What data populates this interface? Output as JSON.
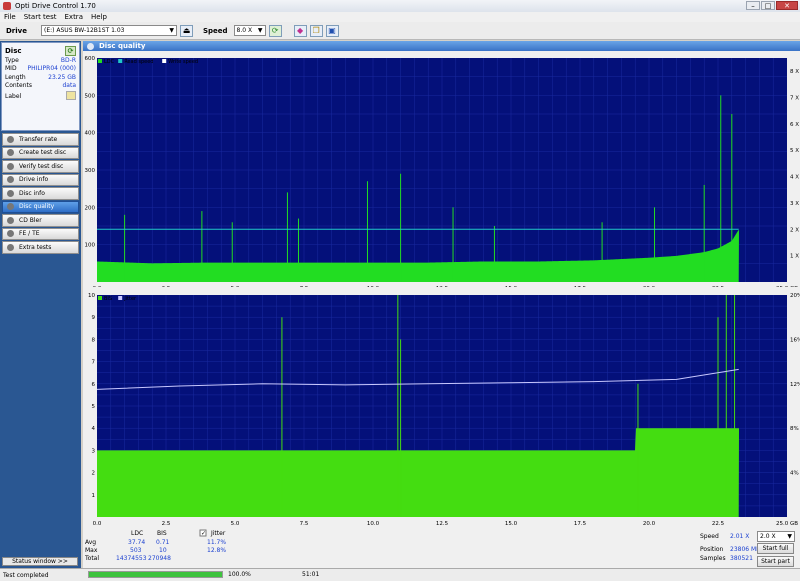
{
  "window": {
    "title": "Opti Drive Control 1.70",
    "controls": [
      "–",
      "□",
      "✕"
    ]
  },
  "menu": [
    "File",
    "Start test",
    "Extra",
    "Help"
  ],
  "toolbar": {
    "drive_label": "Drive",
    "drive_value": "(E:)  ASUS BW-12B1ST 1.03",
    "speed_label": "Speed",
    "speed_value": "8.0 X"
  },
  "disc": {
    "heading": "Disc",
    "rows": [
      {
        "key": "Type",
        "value": "BD-R"
      },
      {
        "key": "MID",
        "value": "PHILIPR04 (000)"
      },
      {
        "key": "Length",
        "value": "23.25 GB"
      },
      {
        "key": "Contents",
        "value": "data"
      },
      {
        "key": "Label",
        "value": ""
      }
    ]
  },
  "nav": [
    {
      "label": "Transfer rate",
      "active": false
    },
    {
      "label": "Create test disc",
      "active": false
    },
    {
      "label": "Verify test disc",
      "active": false
    },
    {
      "label": "Drive info",
      "active": false
    },
    {
      "label": "Disc info",
      "active": false
    },
    {
      "label": "Disc quality",
      "active": true
    },
    {
      "label": "CD Bler",
      "active": false
    },
    {
      "label": "FE / TE",
      "active": false
    },
    {
      "label": "Extra tests",
      "active": false
    }
  ],
  "status_window_label": "Status window >>",
  "panel_title": "Disc quality",
  "chart_data": [
    {
      "type": "area",
      "legend": [
        "LDC",
        "Read speed",
        "Write speed"
      ],
      "legend_placement": "top-left",
      "x_ticks": [
        "0.0",
        "2.5",
        "5.0",
        "7.5",
        "10.0",
        "12.5",
        "15.0",
        "17.5",
        "20.0",
        "22.5",
        "25.0 GB"
      ],
      "y_ticks_left": [
        "100",
        "200",
        "300",
        "400",
        "500",
        "600"
      ],
      "y_ticks_right": [
        "1 X",
        "2 X",
        "3 X",
        "4 X",
        "5 X",
        "6 X",
        "7 X",
        "8 X"
      ],
      "xlim": [
        0,
        25
      ],
      "ylim": [
        0,
        600
      ],
      "y2lim": [
        0,
        8.5
      ],
      "grid": true,
      "series": [
        {
          "name": "LDC",
          "color": "#22dd22",
          "x": [
            0,
            2,
            4,
            6,
            8,
            10,
            12,
            14,
            16,
            18,
            20,
            21,
            22,
            22.5,
            23,
            23.25
          ],
          "y": [
            55,
            50,
            52,
            52,
            52,
            52,
            52,
            55,
            55,
            58,
            65,
            70,
            80,
            90,
            110,
            140
          ]
        },
        {
          "name": "Read speed",
          "color": "#20c8c8",
          "x": [
            0,
            23.25
          ],
          "y": [
            2.0,
            2.0
          ]
        }
      ],
      "spikes": [
        {
          "x": 1.0,
          "y": 180
        },
        {
          "x": 3.8,
          "y": 190
        },
        {
          "x": 4.9,
          "y": 160
        },
        {
          "x": 6.9,
          "y": 240
        },
        {
          "x": 7.3,
          "y": 170
        },
        {
          "x": 9.8,
          "y": 270
        },
        {
          "x": 11.0,
          "y": 290
        },
        {
          "x": 12.9,
          "y": 200
        },
        {
          "x": 14.4,
          "y": 150
        },
        {
          "x": 18.3,
          "y": 160
        },
        {
          "x": 20.2,
          "y": 200
        },
        {
          "x": 22.0,
          "y": 260
        },
        {
          "x": 22.6,
          "y": 500
        },
        {
          "x": 23.0,
          "y": 450
        }
      ]
    },
    {
      "type": "area",
      "legend": [
        "BIS",
        "Jitter"
      ],
      "legend_placement": "top-left",
      "x_ticks": [
        "0.0",
        "2.5",
        "5.0",
        "7.5",
        "10.0",
        "12.5",
        "15.0",
        "17.5",
        "20.0",
        "22.5",
        "25.0 GB"
      ],
      "y_ticks_left": [
        "1",
        "2",
        "3",
        "4",
        "5",
        "6",
        "7",
        "8",
        "9",
        "10"
      ],
      "y_ticks_right": [
        "4%",
        "8%",
        "12%",
        "16%",
        "20%"
      ],
      "xlim": [
        0,
        25
      ],
      "ylim": [
        0,
        10
      ],
      "y2lim": [
        0,
        20
      ],
      "grid": true,
      "series": [
        {
          "name": "BIS",
          "color": "#44dd11",
          "x": [
            0,
            19.5,
            19.5,
            23.25
          ],
          "y": [
            3,
            3,
            4,
            4
          ]
        },
        {
          "name": "Jitter",
          "color": "#c8c8ff",
          "x": [
            0,
            3,
            6,
            9,
            12,
            15,
            18,
            21,
            23.25
          ],
          "y": [
            11.5,
            11.8,
            12.0,
            11.9,
            12.0,
            12.1,
            12.2,
            12.4,
            13.3
          ]
        }
      ],
      "spikes": [
        {
          "x": 6.7,
          "y": 9
        },
        {
          "x": 11.0,
          "y": 8
        },
        {
          "x": 10.9,
          "y": 10
        },
        {
          "x": 19.6,
          "y": 6
        },
        {
          "x": 22.5,
          "y": 9
        },
        {
          "x": 22.8,
          "y": 10
        },
        {
          "x": 23.1,
          "y": 10
        }
      ]
    }
  ],
  "stats": {
    "headers": [
      "LDC",
      "BIS"
    ],
    "jitter_label": "Jitter",
    "jitter_checked": true,
    "rows": [
      {
        "label": "Avg",
        "ldc": "37.74",
        "bis": "0.71",
        "jitter": "11.7%"
      },
      {
        "label": "Max",
        "ldc": "503",
        "bis": "10",
        "jitter": "12.8%"
      },
      {
        "label": "Total",
        "ldc": "14374553",
        "bis": "270948",
        "jitter": ""
      }
    ],
    "speed_label": "Speed",
    "speed_value": "2.01 X",
    "speed_select": "2.0 X",
    "position_label": "Position",
    "position_value": "23806 MB",
    "samples_label": "Samples",
    "samples_value": "380521",
    "start_full": "Start full",
    "start_part": "Start part"
  },
  "status": {
    "text": "Test completed",
    "progress": 1.0,
    "progress_text": "100.0%",
    "elapsed": "51:01"
  }
}
